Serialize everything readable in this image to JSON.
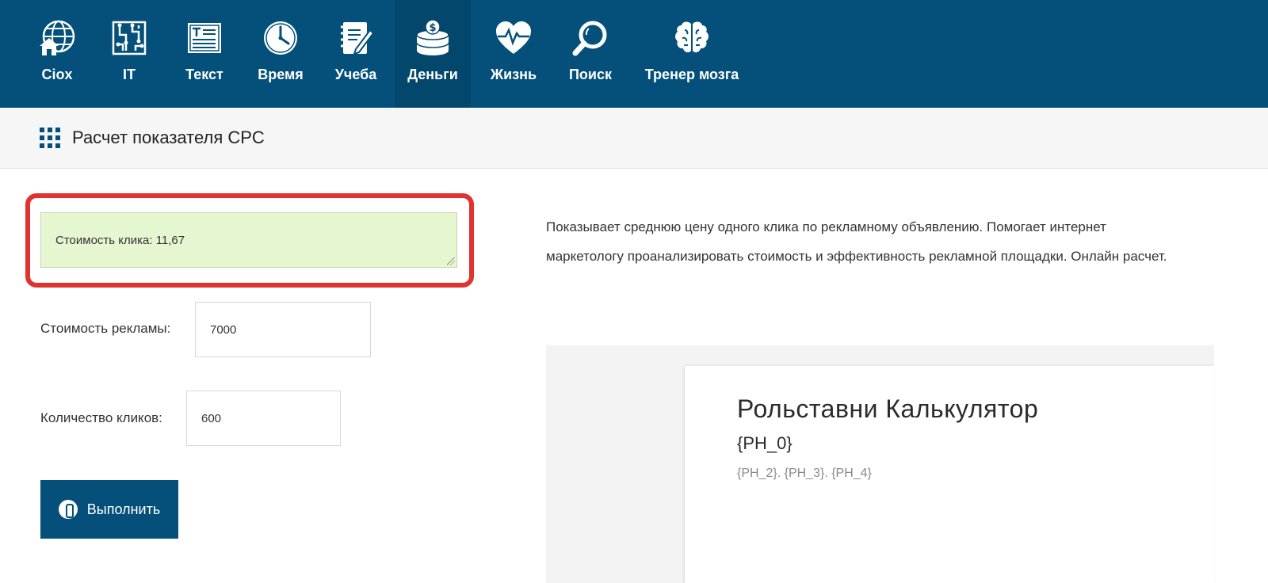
{
  "nav": {
    "items": [
      {
        "label": "Ciox",
        "icon": "house-globe-icon",
        "active": false
      },
      {
        "label": "IT",
        "icon": "circuit-board-icon",
        "active": false
      },
      {
        "label": "Текст",
        "icon": "text-document-icon",
        "active": false
      },
      {
        "label": "Время",
        "icon": "clock-icon",
        "active": false
      },
      {
        "label": "Учеба",
        "icon": "notebook-pen-icon",
        "active": false
      },
      {
        "label": "Деньги",
        "icon": "coin-stack-icon",
        "active": true
      },
      {
        "label": "Жизнь",
        "icon": "heart-pulse-icon",
        "active": false
      },
      {
        "label": "Поиск",
        "icon": "magnifier-icon",
        "active": false
      },
      {
        "label": "Тренер мозга",
        "icon": "brain-icon",
        "active": false
      }
    ]
  },
  "page": {
    "title": "Расчет показателя CPC"
  },
  "form": {
    "result_text": "Стоимость клика: 11,67",
    "ad_cost_label": "Стоимость рекламы:",
    "ad_cost_value": "7000",
    "clicks_label": "Количество кликов:",
    "clicks_value": "600",
    "run_label": "Выполнить"
  },
  "description": {
    "text": "Показывает среднюю цену одного клика по рекламному объявлению. Помогает интернет маркетологу проанализировать стоимость и эффективность рекламной площадки. Онлайн расчет."
  },
  "ad": {
    "title": "Рольставни Калькулятор",
    "subtitle": "{PH_0}",
    "small": "{PH_2}. {PH_3}. {PH_4}"
  },
  "colors": {
    "nav_bg": "#04507a",
    "nav_active_bg": "#03476d",
    "result_bg": "#e6f6d1",
    "highlight_border": "#e0322e",
    "button_bg": "#04507a"
  }
}
